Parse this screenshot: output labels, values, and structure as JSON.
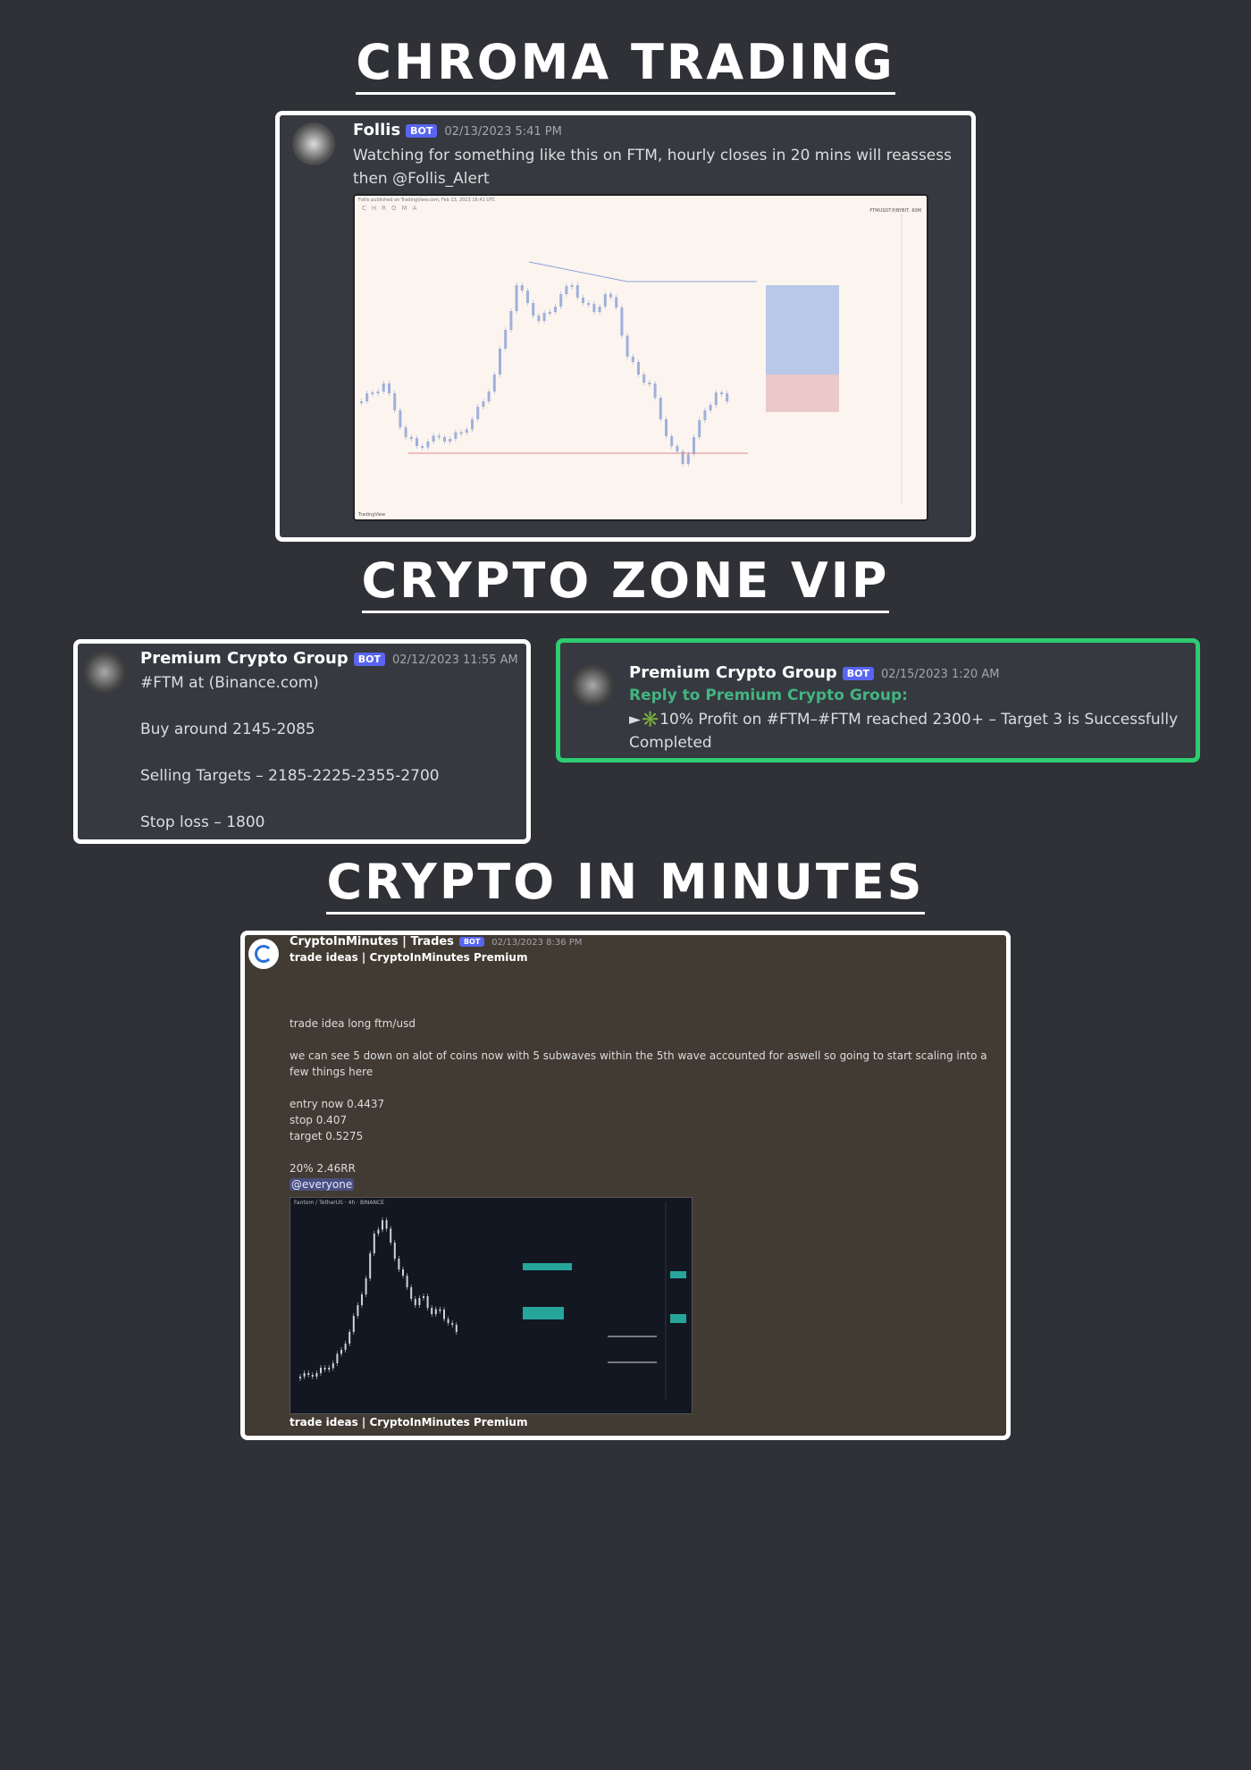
{
  "headings": {
    "chroma": "CHROMA TRADING",
    "zone": "CRYPTO ZONE VIP",
    "minutes": "CRYPTO IN MINUTES"
  },
  "chroma_msg": {
    "username": "Follis",
    "badge": "BOT",
    "timestamp": "02/13/2023 5:41 PM",
    "text_line1": "Watching for something like this on FTM, hourly closes in 20 mins will reassess",
    "text_line2": "then @Follis_Alert",
    "chart_header": "Follis published on TradingView.com, Feb 13, 2023 16:41 UTC",
    "chart_brand": "CHROMA",
    "chart_pair": "FTMUSDT.P/BYBIT, 60M",
    "chart_footer": "TradingView"
  },
  "zone_msg1": {
    "username": "Premium Crypto Group",
    "badge": "BOT",
    "timestamp": "02/12/2023 11:55 AM",
    "line1": "#FTM at (Binance.com)",
    "line2": "Buy around 2145-2085",
    "line3": "Selling Targets – 2185-2225-2355-2700",
    "line4": "Stop loss – 1800"
  },
  "zone_msg2": {
    "username": "Premium Crypto Group",
    "badge": "BOT",
    "timestamp": "02/15/2023 1:20 AM",
    "reply": "Reply to Premium Crypto Group:",
    "line1": "►✳️10% Profit on #FTM–#FTM reached 2300+ – Target 3 is Successfully",
    "line2": "Completed"
  },
  "minutes_msg": {
    "username": "CryptoInMinutes | Trades",
    "badge": "BOT",
    "timestamp": "02/13/2023 8:36 PM",
    "header": "trade ideas | CryptoInMinutes Premium",
    "idea": "trade idea long ftm/usd",
    "analysis": "we can see 5 down on alot of coins now with 5 subwaves within the 5th wave accounted for aswell so going to start scaling into a few things here",
    "entry": "entry now 0.4437",
    "stop": "stop 0.407",
    "target": "target 0.5275",
    "rr": "20% 2.46RR",
    "mention": "@everyone",
    "chart_title": "Fantom / TetherUS · 4h · BINANCE",
    "footer": "trade ideas | CryptoInMinutes Premium"
  },
  "colors": {
    "background": "#2f3136",
    "card": "#36393f",
    "accent_green": "#2ecc71",
    "reply_green": "#43b581",
    "badge": "#5865f2"
  }
}
